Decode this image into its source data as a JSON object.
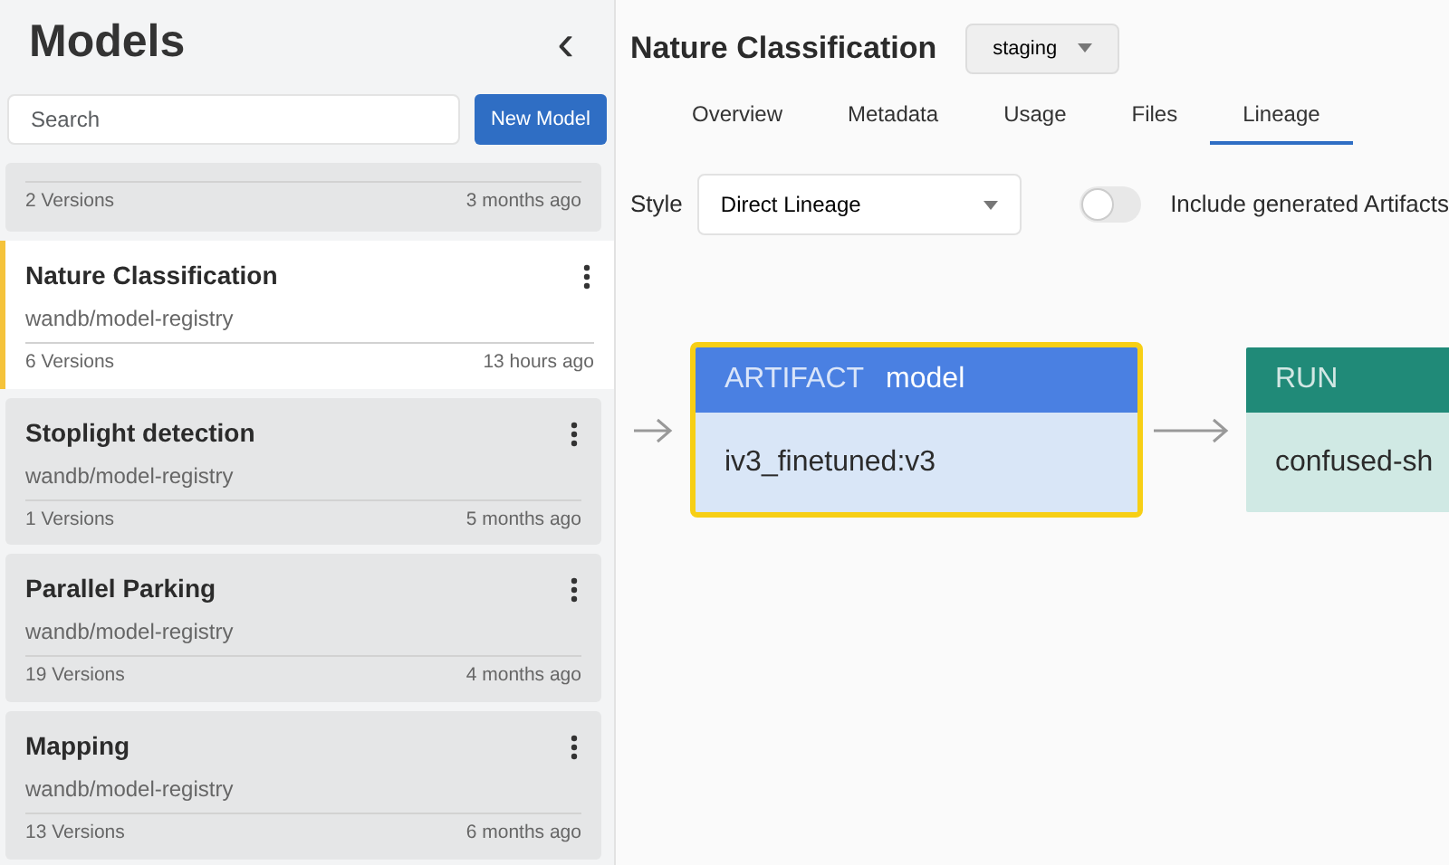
{
  "sidebar": {
    "title": "Models",
    "collapse_icon": "‹",
    "search": {
      "placeholder": "Search"
    },
    "new_button": "New Model",
    "models": [
      {
        "versions": "2 Versions",
        "updated": "3 months ago",
        "selected": false
      },
      {
        "name": "Nature Classification",
        "org": "wandb/model-registry",
        "versions": "6 Versions",
        "updated": "13 hours ago",
        "selected": true
      },
      {
        "name": "Stoplight detection",
        "org": "wandb/model-registry",
        "versions": "1 Versions",
        "updated": "5 months ago",
        "selected": false
      },
      {
        "name": "Parallel Parking",
        "org": "wandb/model-registry",
        "versions": "19 Versions",
        "updated": "4 months ago",
        "selected": false
      },
      {
        "name": "Mapping",
        "org": "wandb/model-registry",
        "versions": "13 Versions",
        "updated": "6 months ago",
        "selected": false
      }
    ]
  },
  "header": {
    "title": "Nature Classification",
    "alias": "staging"
  },
  "tabs": [
    {
      "label": "Overview",
      "selected": false
    },
    {
      "label": "Metadata",
      "selected": false
    },
    {
      "label": "Usage",
      "selected": false
    },
    {
      "label": "Files",
      "selected": false
    },
    {
      "label": "Lineage",
      "selected": true
    }
  ],
  "controls": {
    "style_label": "Style",
    "style_value": "Direct Lineage",
    "include_generated": {
      "label": "Include generated Artifacts",
      "on": false
    }
  },
  "lineage": [
    {
      "kind": "artifact",
      "type_label": "ARTIFACT",
      "type_name": "model",
      "name": "iv3_finetuned:v3",
      "selected": true
    },
    {
      "kind": "run",
      "type_label": "RUN",
      "name": "confused-sh",
      "selected": false
    }
  ]
}
